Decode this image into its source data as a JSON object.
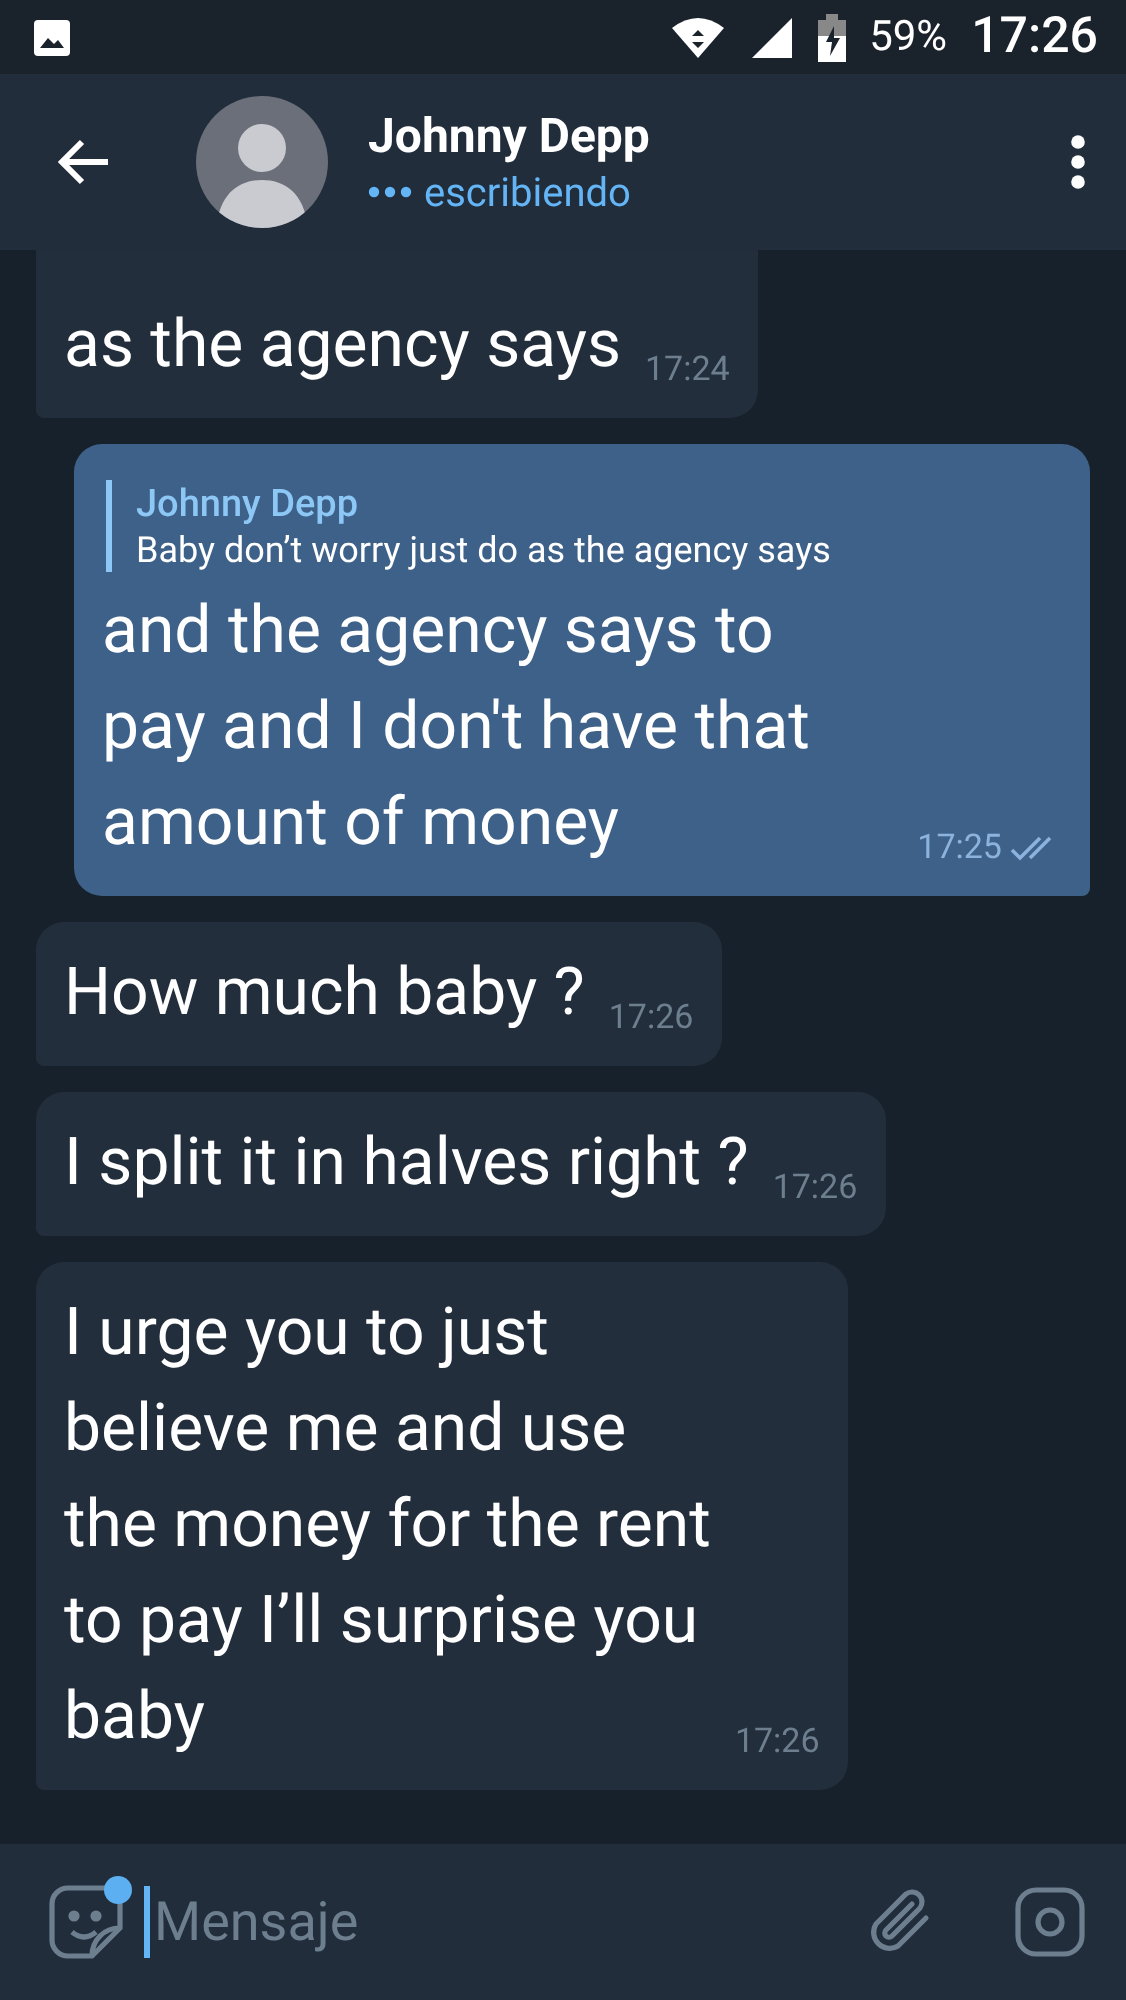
{
  "status_bar": {
    "battery": "59%",
    "time": "17:26"
  },
  "header": {
    "name": "Johnny Depp",
    "status": "escribiendo"
  },
  "messages": [
    {
      "kind": "incoming",
      "text": "as the agency says",
      "time": "17:24"
    },
    {
      "kind": "outgoing",
      "reply": {
        "author": "Johnny Depp",
        "text": "Baby don’t worry just do as the agency says"
      },
      "text": "and the agency says to\npay and I don't have that\namount of money",
      "time": "17:25",
      "read": true
    },
    {
      "kind": "incoming",
      "text": "How much baby ?",
      "time": "17:26"
    },
    {
      "kind": "incoming",
      "text": "I split it in halves right ?",
      "time": "17:26"
    },
    {
      "kind": "incoming",
      "text": "I urge you to just\nbelieve me and use\nthe money for the rent\nto pay I’ll surprise you\nbaby",
      "time": "17:26"
    }
  ],
  "composer": {
    "placeholder": "Mensaje"
  }
}
